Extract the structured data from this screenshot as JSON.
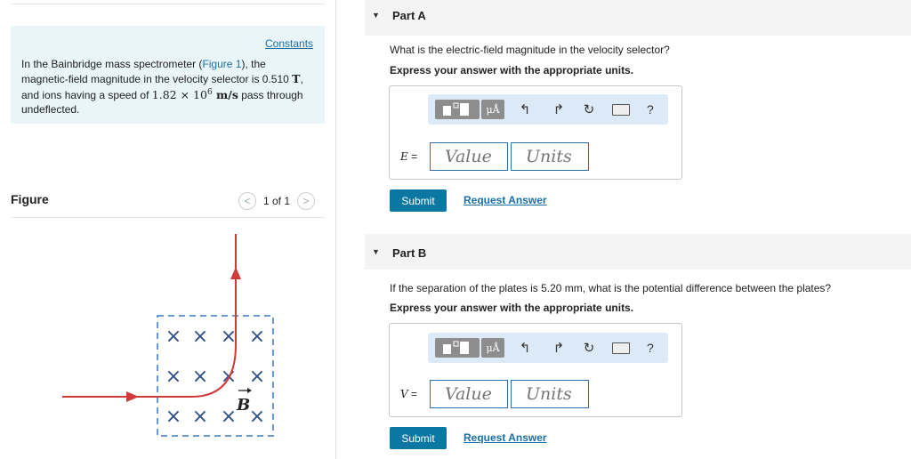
{
  "left": {
    "constants_link": "Constants",
    "intro": {
      "p1": "In the Bainbridge mass spectrometer (",
      "figure_link": "Figure 1",
      "p2": "), the magnetic-field magnitude in the velocity selector is 0.510 ",
      "unit_T": "T",
      "p3": ", and ions having a speed of ",
      "speed": "1.82 × 10",
      "speed_exp": "6",
      "speed_unit": " m/s",
      "p4": " pass through undeflected."
    },
    "figure_label": "Figure",
    "pager": {
      "text": "1 of 1",
      "prev": "<",
      "next": ">"
    },
    "figure": {
      "field_label": "B",
      "cross_symbol": "×",
      "colors": {
        "path": "#d03a3a",
        "box": "#3a78c0",
        "cross": "#2d4f8a"
      }
    }
  },
  "parts": [
    {
      "title": "Part A",
      "question": "What is the electric-field magnitude in the velocity selector?",
      "instruction": "Express your answer with the appropriate units.",
      "variable": "E",
      "value_placeholder": "Value",
      "units_placeholder": "Units",
      "submit": "Submit",
      "request": "Request Answer"
    },
    {
      "title": "Part B",
      "question": "If the separation of the plates is 5.20 mm, what is the potential difference between the plates?",
      "instruction": "Express your answer with the appropriate units.",
      "variable": "V",
      "value_placeholder": "Value",
      "units_placeholder": "Units",
      "submit": "Submit",
      "request": "Request Answer"
    }
  ],
  "toolbar": {
    "mu_label": "μÅ",
    "undo_icon": "undo-icon",
    "redo_icon": "redo-icon",
    "reset_icon": "reset-icon",
    "keyboard_icon": "keyboard-icon",
    "help": "?"
  },
  "colors": {
    "accent": "#0b78a3",
    "link": "#1a6fa8",
    "toolbar_bg": "#dce9f7",
    "intro_bg": "#e9f5f8"
  }
}
